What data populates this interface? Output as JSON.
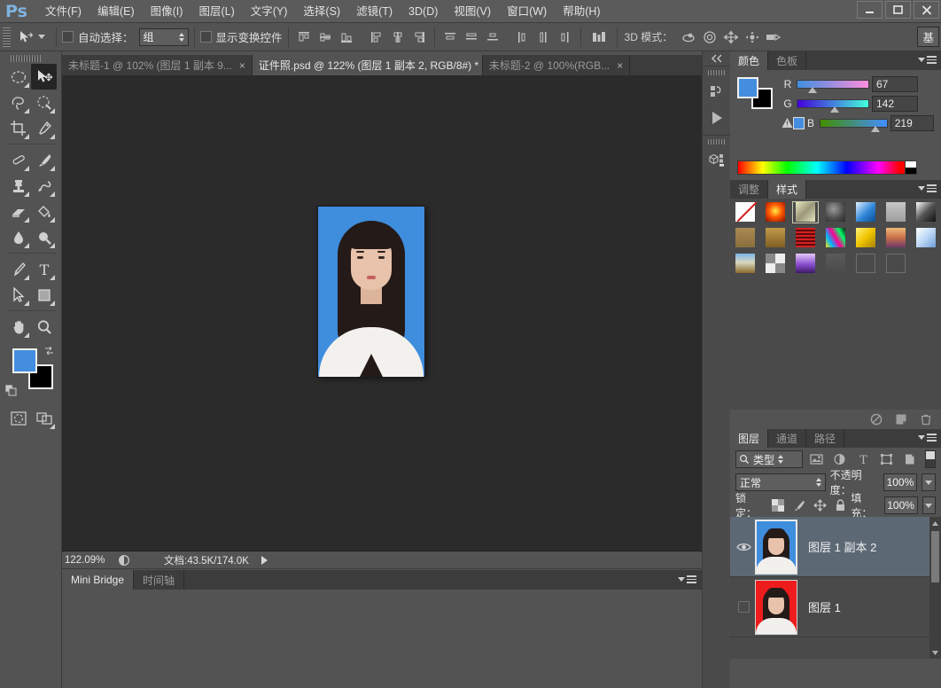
{
  "app": {
    "logo": "Ps",
    "window_controls": {
      "minimize": "—",
      "maximize": "▫",
      "close": "✕"
    }
  },
  "menubar": {
    "items": [
      {
        "label": "文件(F)",
        "name": "menu-file"
      },
      {
        "label": "编辑(E)",
        "name": "menu-edit"
      },
      {
        "label": "图像(I)",
        "name": "menu-image"
      },
      {
        "label": "图层(L)",
        "name": "menu-layer"
      },
      {
        "label": "文字(Y)",
        "name": "menu-type"
      },
      {
        "label": "选择(S)",
        "name": "menu-select"
      },
      {
        "label": "滤镜(T)",
        "name": "menu-filter"
      },
      {
        "label": "3D(D)",
        "name": "menu-3d"
      },
      {
        "label": "视图(V)",
        "name": "menu-view"
      },
      {
        "label": "窗口(W)",
        "name": "menu-window"
      },
      {
        "label": "帮助(H)",
        "name": "menu-help"
      }
    ]
  },
  "options_bar": {
    "auto_select_label": "自动选择：",
    "auto_select_value": "组",
    "show_transform_label": "显示变换控件",
    "mode_3d_label": "3D 模式：",
    "workspace_label": "基"
  },
  "document_tabs": [
    {
      "label": "未标题-1 @ 102% (图层 1 副本 9...",
      "active": false,
      "close": "×"
    },
    {
      "label": "证件照.psd @ 122% (图层 1 副本 2, RGB/8#) *",
      "active": true,
      "close": "×"
    },
    {
      "label": "未标题-2 @ 100%(RGB...",
      "active": false,
      "close": "×"
    }
  ],
  "toolbox": {
    "tools": [
      {
        "name": "elliptical-marquee-tool",
        "selected": false
      },
      {
        "name": "move-tool",
        "selected": true
      },
      {
        "name": "lasso-tool",
        "selected": false
      },
      {
        "name": "quick-selection-tool",
        "selected": false
      },
      {
        "name": "crop-tool",
        "selected": false
      },
      {
        "name": "eyedropper-tool",
        "selected": false
      },
      {
        "name": "healing-brush-tool",
        "selected": false
      },
      {
        "name": "brush-tool",
        "selected": false
      },
      {
        "name": "clone-stamp-tool",
        "selected": false
      },
      {
        "name": "history-brush-tool",
        "selected": false
      },
      {
        "name": "eraser-tool",
        "selected": false
      },
      {
        "name": "paint-bucket-tool",
        "selected": false
      },
      {
        "name": "blur-tool",
        "selected": false
      },
      {
        "name": "dodge-tool",
        "selected": false
      },
      {
        "name": "pen-tool",
        "selected": false
      },
      {
        "name": "type-tool",
        "selected": false
      },
      {
        "name": "path-selection-tool",
        "selected": false
      },
      {
        "name": "rectangle-tool",
        "selected": false
      },
      {
        "name": "hand-tool",
        "selected": false
      },
      {
        "name": "zoom-tool",
        "selected": false
      }
    ],
    "foreground_color": "#438ede",
    "background_color": "#000000",
    "quick-mask": "edit-in-quick-mask-mode",
    "screen-mode": "change-screen-mode"
  },
  "canvas": {
    "background": "#2b2b2b",
    "image_alt": "证件照 - id photo with blue background"
  },
  "status_bar": {
    "zoom": "122.09%",
    "doc_info": "文档:43.5K/174.0K"
  },
  "bottom_dock": {
    "tabs": [
      {
        "label": "Mini Bridge",
        "active": true
      },
      {
        "label": "时间轴",
        "active": false
      }
    ]
  },
  "color_panel": {
    "tabs": [
      {
        "label": "颜色",
        "active": true
      },
      {
        "label": "色板",
        "active": false
      }
    ],
    "channels": [
      {
        "label": "R",
        "value": "67",
        "pct": 26
      },
      {
        "label": "G",
        "value": "142",
        "pct": 56
      },
      {
        "label": "B",
        "value": "219",
        "pct": 86
      }
    ],
    "foreground": "#438ede",
    "background": "#000000"
  },
  "styles_panel": {
    "tabs": [
      {
        "label": "调整",
        "active": false
      },
      {
        "label": "样式",
        "active": true
      }
    ],
    "swatches": [
      {
        "name": "style-none",
        "css": "linear-gradient(135deg,#ffffff 0%,#ffffff 100%)",
        "selected": false,
        "slash": true
      },
      {
        "name": "style-red-glow",
        "css": "radial-gradient(circle at 50% 45%, #ffef4a 0%, #ff5a00 45%, #8b0f00 100%)",
        "selected": false
      },
      {
        "name": "style-beige-bevel",
        "css": "linear-gradient(135deg,#e8e5c0 0%,#9a9878 50%,#e8e5c0 100%)",
        "selected": true
      },
      {
        "name": "style-dark-metal",
        "css": "radial-gradient(circle at 40% 35%, #9a9a9a 0%, #4a4a4a 60%, #2a2a2a 100%)",
        "selected": false
      },
      {
        "name": "style-blue-gradient",
        "css": "linear-gradient(135deg,#dff0ff 0%,#2f86d9 55%,#0d4f94 100%)",
        "selected": false
      },
      {
        "name": "style-gray-flat",
        "css": "linear-gradient(180deg,#c6c6c6 0%,#9e9e9e 100%)",
        "selected": false
      },
      {
        "name": "style-black-white-fade",
        "css": "linear-gradient(135deg,#ffffff 0%,#555 50%,#111 100%)",
        "selected": false
      },
      {
        "name": "style-tan-1",
        "css": "linear-gradient(180deg,#a98a52 0%,#8a6e3d 100%)",
        "selected": false
      },
      {
        "name": "style-tan-2",
        "css": "linear-gradient(180deg,#c09a4a 0%,#7f5f22 100%)",
        "selected": false
      },
      {
        "name": "style-red-stripes",
        "css": "repeating-linear-gradient(0deg,#d62020 0 2px,#5d0b0b 2px 4px)",
        "selected": false
      },
      {
        "name": "style-rainbow-noise",
        "css": "linear-gradient(60deg,#ffe600 0%,#00b3ff 25%,#ff0090 50%,#00ff66 75%,#111 100%)",
        "selected": false
      },
      {
        "name": "style-yellow-bevel",
        "css": "linear-gradient(135deg,#fff47a 0%,#f0c400 50%,#a88200 100%)",
        "selected": false
      },
      {
        "name": "style-sunset",
        "css": "linear-gradient(180deg,#f0b97a 0%,#c9714a 50%,#6f3a6a 100%)",
        "selected": false
      },
      {
        "name": "style-light-blue-bevel",
        "css": "linear-gradient(135deg,#ffffff 0%,#bcd7f5 50%,#6f9fd8 100%)",
        "selected": false
      },
      {
        "name": "style-landscape",
        "css": "linear-gradient(180deg,#7ab6e8 0%,#d8d8c0 45%,#8a6a2a 100%)",
        "selected": false
      },
      {
        "name": "style-noise-texture",
        "css": "repeating-conic-gradient(#eee 0% 25%, #888 0% 50%)",
        "selected": false
      },
      {
        "name": "style-purple-bevel",
        "css": "linear-gradient(180deg,#e4c8f7 0%,#8a4fd0 55%,#3d1a66 100%)",
        "selected": false
      },
      {
        "name": "style-empty-1",
        "css": "linear-gradient(180deg,#5a5a5a 0%,#4a4a4a 100%)",
        "selected": false
      },
      {
        "name": "style-empty-2",
        "css": "none",
        "selected": false,
        "outline": true
      },
      {
        "name": "style-empty-3",
        "css": "none",
        "selected": false,
        "outline": true
      },
      {
        "name": "style-blank",
        "css": "none",
        "selected": false,
        "blank": true
      }
    ]
  },
  "layers_panel": {
    "tabs": [
      {
        "label": "图层",
        "active": true
      },
      {
        "label": "通道",
        "active": false
      },
      {
        "label": "路径",
        "active": false
      }
    ],
    "filter_type_label": "类型",
    "blend_mode": "正常",
    "opacity_label": "不透明度：",
    "opacity_value": "100%",
    "lock_label": "锁定：",
    "fill_label": "填充：",
    "fill_value": "100%",
    "layers": [
      {
        "name": "图层 1 副本 2",
        "visible": true,
        "selected": true,
        "thumb_bg": "#3f8ddd"
      },
      {
        "name": "图层 1",
        "visible": false,
        "selected": false,
        "thumb_bg": "#ee1c1c"
      }
    ]
  }
}
